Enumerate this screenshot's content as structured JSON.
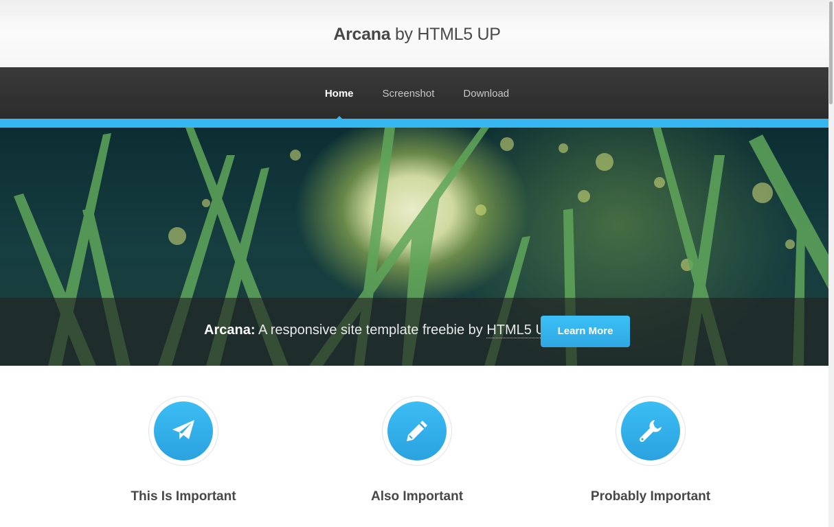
{
  "header": {
    "title_strong": "Arcana",
    "title_rest": " by HTML5 UP"
  },
  "nav": {
    "items": [
      {
        "label": "Home"
      },
      {
        "label": "Screenshot"
      },
      {
        "label": "Download"
      }
    ]
  },
  "banner": {
    "title": "Arcana:",
    "text": "A responsive site template freebie by",
    "link": "HTML5 UP",
    "button": "Learn More"
  },
  "features": [
    {
      "title": "This Is Important",
      "icon": "paper-plane-icon"
    },
    {
      "title": "Also Important",
      "icon": "pencil-icon"
    },
    {
      "title": "Probably Important",
      "icon": "wrench-icon"
    }
  ],
  "colors": {
    "accent": "#37b7f2",
    "nav_bg": "#2f2f2f",
    "text": "#474747"
  }
}
